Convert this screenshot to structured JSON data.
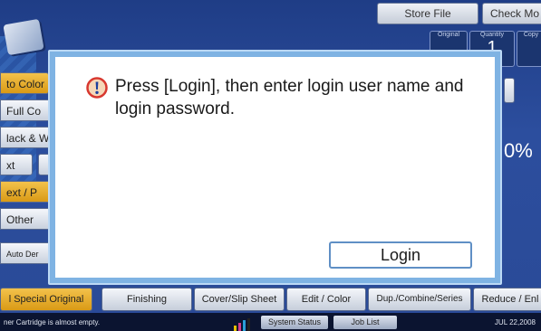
{
  "top_buttons": [
    "Store File",
    "Check Mo"
  ],
  "counters": [
    {
      "label": "Original",
      "value": ""
    },
    {
      "label": "Quantity",
      "value": "1"
    },
    {
      "label": "Copy",
      "value": ""
    }
  ],
  "left_panel": [
    "to Color",
    "Full Co",
    "lack & W",
    "xt",
    "ext / P",
    "Other",
    "Auto Der"
  ],
  "zoom_text": "0%",
  "tabs": [
    "l Special Original",
    "Finishing",
    "Cover/Slip Sheet",
    "Edit / Color",
    "Dup./Combine/Series",
    "Reduce / Enl"
  ],
  "status": {
    "message": "ner Cartridge is almost empty.",
    "system_status": "System Status",
    "job_list": "Job List",
    "date": "JUL  22,2008"
  },
  "dialog": {
    "message": "Press [Login], then enter login user name and login password.",
    "login_label": "Login",
    "icon": "warning-icon"
  },
  "colors": {
    "selected": "#f3c24b",
    "dialog_frame": "#7fb3e3",
    "login_border": "#5f8fc5",
    "icon_red": "#d8382f"
  }
}
